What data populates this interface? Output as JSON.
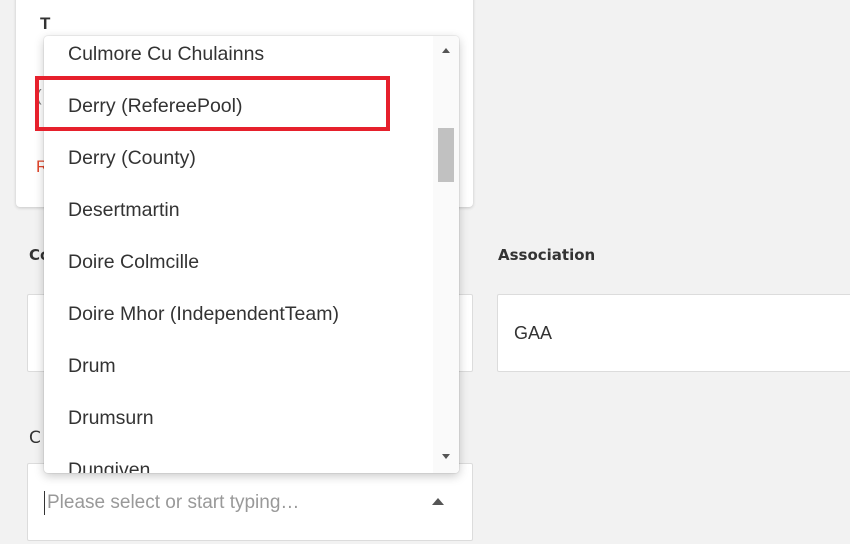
{
  "top_card": {
    "frag_title": "T",
    "frag_line": "(",
    "frag_link": "R"
  },
  "fields": {
    "left_label": "Co",
    "association_label": "Association",
    "association_value": "GAA",
    "club_label": "C"
  },
  "club_select": {
    "placeholder": "Please select or start typing…",
    "options": [
      "Culmore Cu Chulainns",
      "Derry (RefereePool)",
      "Derry (County)",
      "Desertmartin",
      "Doire Colmcille",
      "Doire Mhor (IndependentTeam)",
      "Drum",
      "Drumsurn",
      "Dungiven"
    ],
    "highlighted_option": "Derry (RefereePool)",
    "scroll_position_fraction": 0.21
  },
  "colors": {
    "highlight": "#e6202c",
    "link": "#e0452a"
  }
}
